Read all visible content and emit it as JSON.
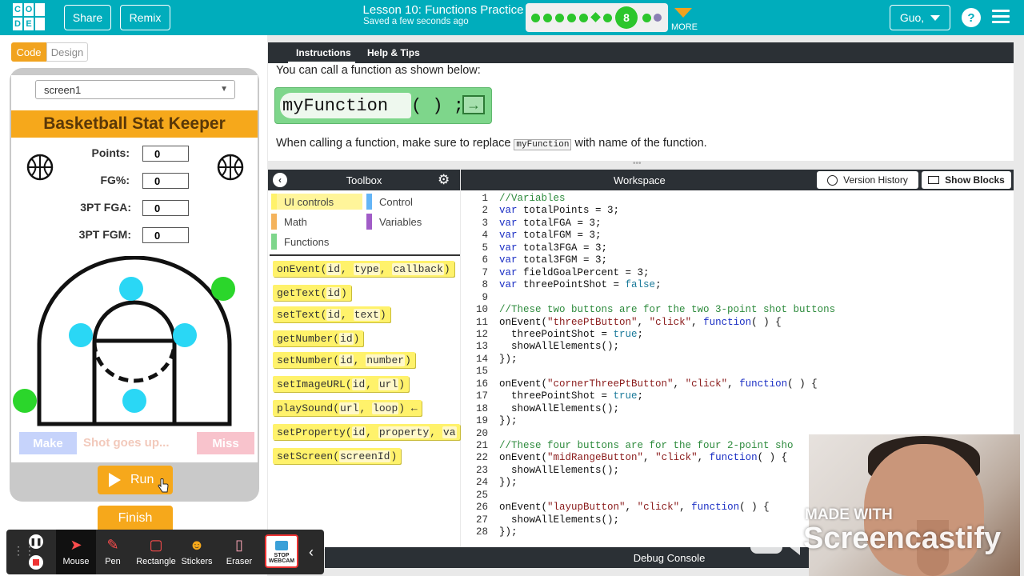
{
  "header": {
    "logo_letters": [
      "C",
      "O",
      "D",
      "E",
      "",
      ""
    ],
    "share_label": "Share",
    "remix_label": "Remix",
    "lesson_title": "Lesson 10: Functions Practice",
    "saved_status": "Saved a few seconds ago",
    "current_level": "8",
    "more_label": "MORE",
    "user_label": "Guo,",
    "help_label": "?"
  },
  "left": {
    "tab_code": "Code",
    "tab_design": "Design",
    "screen_select": "screen1",
    "app_title": "Basketball Stat Keeper",
    "stats": [
      {
        "label": "Points:",
        "value": "0"
      },
      {
        "label": "FG%:",
        "value": "0"
      },
      {
        "label": "3PT FGA:",
        "value": "0"
      },
      {
        "label": "3PT FGM:",
        "value": "0"
      }
    ],
    "make_label": "Make",
    "shot_label": "Shot goes up...",
    "miss_label": "Miss",
    "run_label": "Run",
    "finish_label": "Finish"
  },
  "instructions": {
    "tab_instructions": "Instructions",
    "tab_help": "Help & Tips",
    "line1": "You can call a function as shown below:",
    "block_name": "myFunction",
    "block_parens": "( ) ;",
    "line2_before": "When calling a function, make sure to replace",
    "line2_code": "myFunction",
    "line2_after": "with name of the function."
  },
  "toolbox": {
    "title": "Toolbox",
    "categories": [
      {
        "label": "UI controls",
        "color": "#fff26b"
      },
      {
        "label": "Control",
        "color": "#64b5f6"
      },
      {
        "label": "Math",
        "color": "#f4b35c"
      },
      {
        "label": "Variables",
        "color": "#a15cc7"
      },
      {
        "label": "Functions",
        "color": "#7ed68b"
      }
    ],
    "blocks": [
      {
        "name": "onEvent",
        "params": [
          "id",
          "type",
          "callback"
        ]
      },
      {
        "name": "getText",
        "params": [
          "id"
        ]
      },
      {
        "name": "setText",
        "params": [
          "id",
          "text"
        ]
      },
      {
        "name": "getNumber",
        "params": [
          "id"
        ]
      },
      {
        "name": "setNumber",
        "params": [
          "id",
          "number"
        ]
      },
      {
        "name": "setImageURL",
        "params": [
          "id",
          "url"
        ]
      },
      {
        "name": "playSound",
        "params": [
          "url",
          "loop"
        ]
      },
      {
        "name": "setProperty",
        "params": [
          "id",
          "property",
          "va"
        ]
      },
      {
        "name": "setScreen",
        "params": [
          "screenId"
        ]
      }
    ]
  },
  "workspace": {
    "title": "Workspace",
    "version_history_label": "Version History",
    "show_blocks_label": "Show Blocks",
    "code_lines": [
      "//Variables",
      "var totalPoints = 3;",
      "var totalFGA = 3;",
      "var totalFGM = 3;",
      "var total3FGA = 3;",
      "var total3FGM = 3;",
      "var fieldGoalPercent = 3;",
      "var threePointShot = false;",
      "",
      "//These two buttons are for the two 3-point shot buttons",
      "onEvent(\"threePtButton\", \"click\", function( ) {",
      "  threePointShot = true;",
      "  showAllElements();",
      "});",
      "",
      "onEvent(\"cornerThreePtButton\", \"click\", function( ) {",
      "  threePointShot = true;",
      "  showAllElements();",
      "});",
      "",
      "//These four buttons are for the four 2-point sho",
      "onEvent(\"midRangeButton\", \"click\", function( ) {",
      "  showAllElements();",
      "});",
      "",
      "onEvent(\"layupButton\", \"click\", function( ) {",
      "  showAllElements();",
      "});"
    ],
    "debug_label": "Debug Console"
  },
  "recorder": {
    "tools": [
      "Mouse",
      "Pen",
      "Rectangle",
      "Stickers",
      "Eraser"
    ],
    "stop_webcam_label": "STOP WEBCAM",
    "made_with": "MADE WITH",
    "brand": "Screencastify"
  },
  "colors": {
    "topbar": "#00adbc",
    "accent_orange": "#f6a81b",
    "progress_green": "#2cc62c",
    "dark_header": "#2b3035"
  }
}
